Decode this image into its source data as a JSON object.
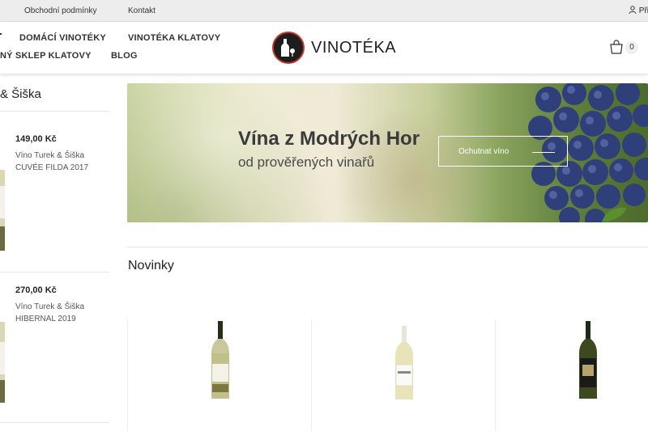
{
  "topbar": {
    "links": [
      "Obchodní podmínky",
      "Kontakt"
    ],
    "user_label": "Při"
  },
  "nav": {
    "items": [
      "DOMÁCÍ VINOTÉKY",
      "VINOTÉKA KLATOVY",
      "NÝ SKLEP KLATOVY",
      "BLOG"
    ]
  },
  "logo": {
    "text": "VINOTÉKA"
  },
  "cart": {
    "count": "0"
  },
  "sidebar": {
    "title": "& Šiška",
    "products": [
      {
        "price": "149,00 Kč",
        "producer": "Víno Turek & Šiška",
        "name": "CUVÉE FILDA 2017"
      },
      {
        "price": "270,00 Kč",
        "producer": "Víno Turek & Šiška",
        "name": "HIBERNAL 2019"
      }
    ]
  },
  "banner": {
    "title": "Vína z Modrých Hor",
    "subtitle": "od prověřených vinařů",
    "button_label": "Ochutnat víno"
  },
  "section": {
    "title": "Novinky"
  },
  "colors": {
    "accent": "#c0392b",
    "banner_text": "#3a3a3a"
  },
  "icons": [
    "user-icon",
    "cart-icon",
    "arrow-right-icon",
    "wine-bottle-icon"
  ]
}
